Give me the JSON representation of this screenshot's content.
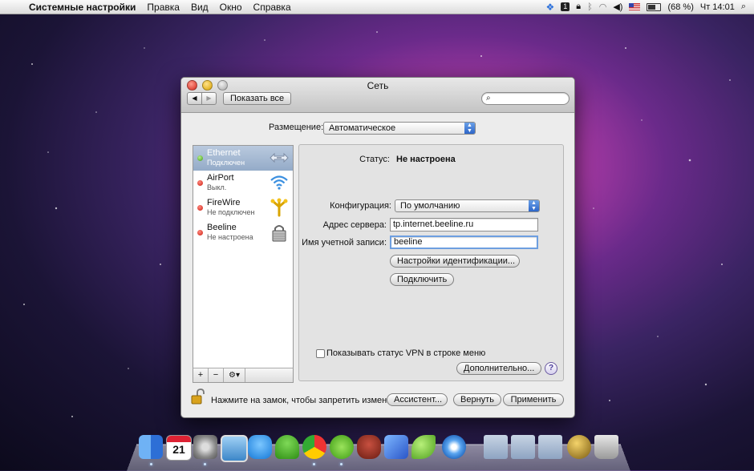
{
  "menubar": {
    "app_name": "Системные настройки",
    "menus": [
      "Правка",
      "Вид",
      "Окно",
      "Справка"
    ],
    "battery": "(68 %)",
    "clock": "Чт 14:01",
    "tray_icons": [
      "dropbox-icon",
      "number-1-icon",
      "lock-icon",
      "bluetooth-icon",
      "wifi-icon",
      "volume-icon",
      "us-flag-icon",
      "battery-icon",
      "spotlight-icon"
    ]
  },
  "window": {
    "title": "Сеть",
    "show_all": "Показать все",
    "search_placeholder": "",
    "location_label": "Размещение:",
    "location_value": "Автоматическое"
  },
  "services": [
    {
      "name": "Ethernet",
      "status": "Подключен",
      "dot": "green",
      "icon": "ethernet-icon",
      "selected": true
    },
    {
      "name": "AirPort",
      "status": "Выкл.",
      "dot": "red",
      "icon": "airport-wifi-icon",
      "selected": false
    },
    {
      "name": "FireWire",
      "status": "Не подключен",
      "dot": "red",
      "icon": "firewire-icon",
      "selected": false
    },
    {
      "name": "Beeline",
      "status": "Не настроена",
      "dot": "red",
      "icon": "vpn-lock-icon",
      "selected": false
    }
  ],
  "sidebar_tools": {
    "add": "+",
    "remove": "−",
    "gear": "⚙▾"
  },
  "detail": {
    "status_label": "Статус:",
    "status_value": "Не настроена",
    "config_label": "Конфигурация:",
    "config_value": "По умолчанию",
    "server_label": "Адрес сервера:",
    "server_value": "tp.internet.beeline.ru",
    "account_label": "Имя учетной записи:",
    "account_value": "beeline",
    "auth_button": "Настройки идентификации...",
    "connect_button": "Подключить",
    "vpn_checkbox_label": "Показывать статус VPN в строке меню",
    "vpn_checkbox_checked": false,
    "advanced_button": "Дополнительно...",
    "help_button": "?"
  },
  "footer": {
    "lock_message": "Нажмите на замок, чтобы запретить изменения.",
    "assistant_button": "Ассистент...",
    "revert_button": "Вернуть",
    "apply_button": "Применить"
  },
  "dock": {
    "items": [
      "finder-icon",
      "ical-icon",
      "system-preferences-icon",
      "preview-icon",
      "skype-icon",
      "adium-icon",
      "chrome-icon",
      "utorrent-icon",
      "growl-icon",
      "xcode-icon",
      "leaf-icon",
      "safari-icon",
      "applications-folder-icon",
      "documents-folder-icon",
      "downloads-folder-icon",
      "stack-icon",
      "trash-icon"
    ],
    "date_badge": "21"
  }
}
